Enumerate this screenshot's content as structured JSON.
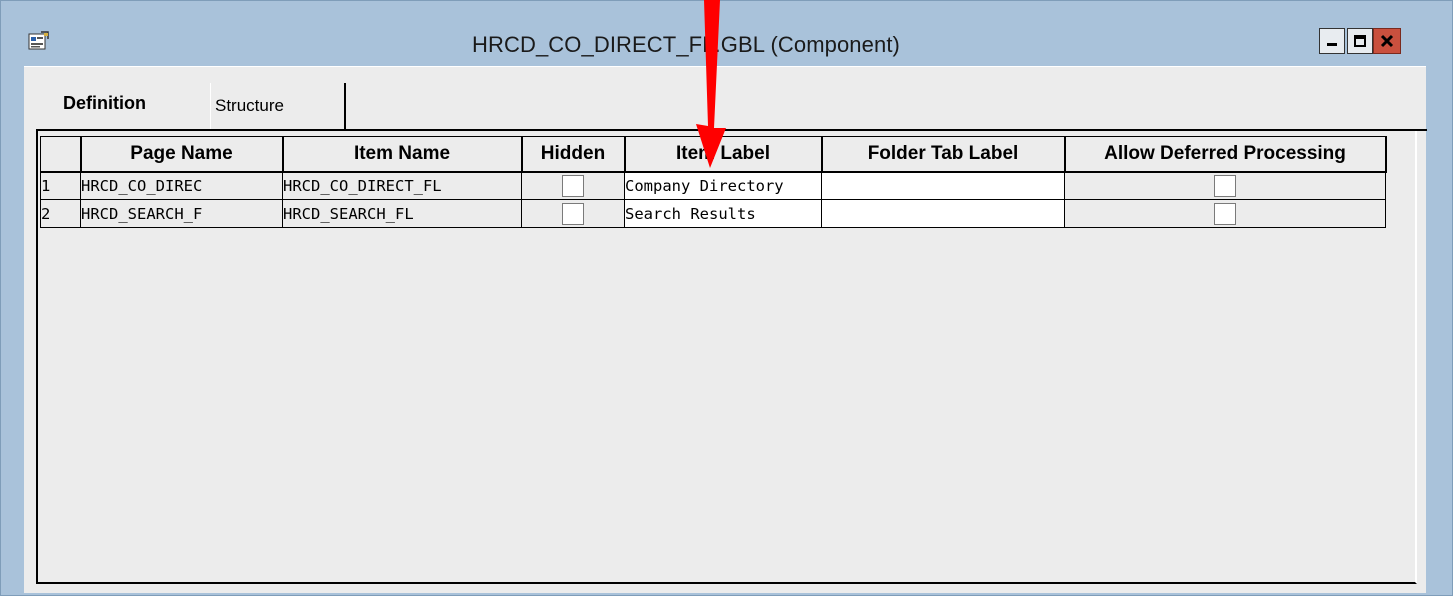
{
  "window": {
    "title": "HRCD_CO_DIRECT_FL.GBL (Component)",
    "app_icon": "component-definition-icon",
    "controls": [
      "minimize-icon",
      "maximize-icon",
      "close-icon"
    ],
    "close_color": "#c9503e",
    "frame_color": "#a9c2da"
  },
  "tabs": [
    {
      "label": "Definition",
      "active": true
    },
    {
      "label": "Structure",
      "active": false
    }
  ],
  "grid": {
    "columns": [
      "",
      "Page Name",
      "Item Name",
      "Hidden",
      "Item Label",
      "Folder Tab Label",
      "Allow Deferred Processing"
    ],
    "rows": [
      {
        "num": "1",
        "page_name": "HRCD_CO_DIREC",
        "item_name": "HRCD_CO_DIRECT_FL",
        "hidden": false,
        "item_label": "Company Directory",
        "folder_tab_label": "",
        "allow_deferred": false
      },
      {
        "num": "2",
        "page_name": "HRCD_SEARCH_F",
        "item_name": "HRCD_SEARCH_FL",
        "hidden": false,
        "item_label": "Search Results",
        "folder_tab_label": "",
        "allow_deferred": false
      }
    ]
  },
  "annotation": {
    "shape": "red-arrow-down",
    "color": "#ff0000"
  }
}
